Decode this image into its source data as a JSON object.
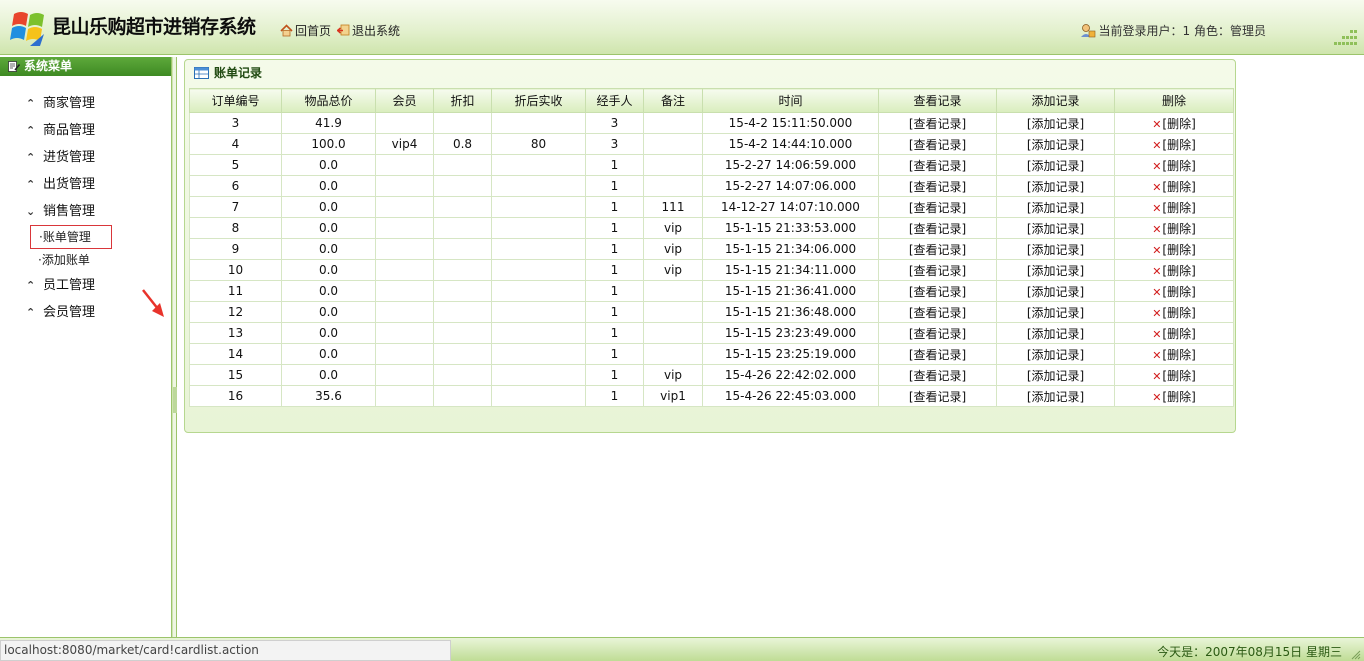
{
  "header": {
    "app_title": "昆山乐购超市进销存系统",
    "home_label": "回首页",
    "logout_label": "退出系统",
    "user_info": "当前登录用户：1 角色：管理员"
  },
  "sidebar": {
    "title": "系统菜单",
    "items": [
      {
        "label": "商家管理",
        "expanded": false
      },
      {
        "label": "商品管理",
        "expanded": false
      },
      {
        "label": "进货管理",
        "expanded": false
      },
      {
        "label": "出货管理",
        "expanded": false
      },
      {
        "label": "销售管理",
        "expanded": true
      },
      {
        "label": "员工管理",
        "expanded": false
      },
      {
        "label": "会员管理",
        "expanded": false
      }
    ],
    "sub_items": [
      {
        "label": "·账单管理",
        "active": true
      },
      {
        "label": "·添加账单",
        "active": false
      }
    ]
  },
  "panel": {
    "title": "账单记录"
  },
  "table": {
    "columns": [
      "订单编号",
      "物品总价",
      "会员",
      "折扣",
      "折后实收",
      "经手人",
      "备注",
      "时间",
      "查看记录",
      "添加记录",
      "删除"
    ],
    "view_label": "[查看记录]",
    "add_label": "[添加记录]",
    "delete_label": "[删除]",
    "rows": [
      {
        "id": "3",
        "total": "41.9",
        "member": "",
        "discount": "",
        "actual": "",
        "handler": "3",
        "note": "",
        "time": "15-4-2 15:11:50.000"
      },
      {
        "id": "4",
        "total": "100.0",
        "member": "vip4",
        "discount": "0.8",
        "actual": "80",
        "handler": "3",
        "note": "",
        "time": "15-4-2 14:44:10.000"
      },
      {
        "id": "5",
        "total": "0.0",
        "member": "",
        "discount": "",
        "actual": "",
        "handler": "1",
        "note": "",
        "time": "15-2-27 14:06:59.000"
      },
      {
        "id": "6",
        "total": "0.0",
        "member": "",
        "discount": "",
        "actual": "",
        "handler": "1",
        "note": "",
        "time": "15-2-27 14:07:06.000"
      },
      {
        "id": "7",
        "total": "0.0",
        "member": "",
        "discount": "",
        "actual": "",
        "handler": "1",
        "note": "111",
        "time": "14-12-27 14:07:10.000"
      },
      {
        "id": "8",
        "total": "0.0",
        "member": "",
        "discount": "",
        "actual": "",
        "handler": "1",
        "note": "vip",
        "time": "15-1-15 21:33:53.000"
      },
      {
        "id": "9",
        "total": "0.0",
        "member": "",
        "discount": "",
        "actual": "",
        "handler": "1",
        "note": "vip",
        "time": "15-1-15 21:34:06.000"
      },
      {
        "id": "10",
        "total": "0.0",
        "member": "",
        "discount": "",
        "actual": "",
        "handler": "1",
        "note": "vip",
        "time": "15-1-15 21:34:11.000"
      },
      {
        "id": "11",
        "total": "0.0",
        "member": "",
        "discount": "",
        "actual": "",
        "handler": "1",
        "note": "",
        "time": "15-1-15 21:36:41.000"
      },
      {
        "id": "12",
        "total": "0.0",
        "member": "",
        "discount": "",
        "actual": "",
        "handler": "1",
        "note": "",
        "time": "15-1-15 21:36:48.000"
      },
      {
        "id": "13",
        "total": "0.0",
        "member": "",
        "discount": "",
        "actual": "",
        "handler": "1",
        "note": "",
        "time": "15-1-15 23:23:49.000"
      },
      {
        "id": "14",
        "total": "0.0",
        "member": "",
        "discount": "",
        "actual": "",
        "handler": "1",
        "note": "",
        "time": "15-1-15 23:25:19.000"
      },
      {
        "id": "15",
        "total": "0.0",
        "member": "",
        "discount": "",
        "actual": "",
        "handler": "1",
        "note": "vip",
        "time": "15-4-26 22:42:02.000"
      },
      {
        "id": "16",
        "total": "35.6",
        "member": "",
        "discount": "",
        "actual": "",
        "handler": "1",
        "note": "vip1",
        "time": "15-4-26 22:45:03.000"
      }
    ]
  },
  "status": {
    "url": "localhost:8080/market/card!cardlist.action",
    "today": "今天是：2007年08月15日 星期三"
  },
  "icons": {
    "logo": "windows-logo-icon",
    "home": "home-icon",
    "logout": "logout-icon",
    "user": "user-lock-icon",
    "menu": "menu-edit-icon",
    "table": "table-icon",
    "collapsed": "double-chevron-up-icon",
    "expanded": "double-chevron-down-icon",
    "delete": "delete-x-icon"
  },
  "colors": {
    "accent_green": "#3e8a23",
    "header_bg": "#e4f1cf",
    "delete_red": "#d21d1d",
    "highlight_border": "#d9363a"
  }
}
